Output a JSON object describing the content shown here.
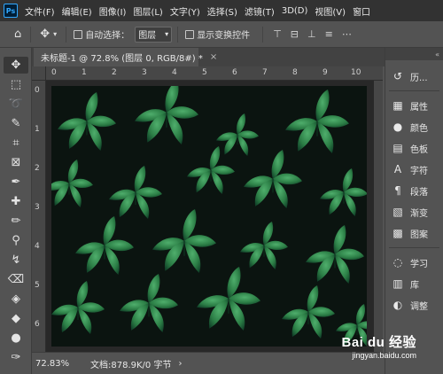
{
  "app": {
    "logo": "Ps"
  },
  "menu": [
    "文件(F)",
    "编辑(E)",
    "图像(I)",
    "图层(L)",
    "文字(Y)",
    "选择(S)",
    "滤镜(T)",
    "3D(D)",
    "视图(V)",
    "窗口"
  ],
  "options": {
    "auto_select_label": "自动选择：",
    "auto_select_value": "图层",
    "show_transform_label": "显示变换控件"
  },
  "document": {
    "tab_title": "未标题-1 @ 72.8% (图层 0, RGB/8#) *",
    "close_glyph": "×"
  },
  "rulers": {
    "horizontal": [
      "0",
      "1",
      "2",
      "3",
      "4",
      "5",
      "6",
      "7",
      "8",
      "9",
      "10"
    ],
    "vertical": [
      "0",
      "1",
      "2",
      "3",
      "4",
      "5",
      "6"
    ]
  },
  "status": {
    "zoom": "72.83%",
    "doc_info": "文档:878.9K/0 字节",
    "arrow": "›"
  },
  "panels": {
    "top_glyph": "«",
    "items": [
      {
        "icon": "history-icon",
        "glyph": "↺",
        "label": "历..."
      },
      {
        "icon": "properties-icon",
        "glyph": "▦",
        "label": "属性"
      },
      {
        "icon": "color-icon",
        "glyph": "●",
        "label": "颜色"
      },
      {
        "icon": "swatches-icon",
        "glyph": "▤",
        "label": "色板"
      },
      {
        "icon": "character-icon",
        "glyph": "A",
        "label": "字符"
      },
      {
        "icon": "paragraph-icon",
        "glyph": "¶",
        "label": "段落"
      },
      {
        "icon": "gradient-icon",
        "glyph": "▧",
        "label": "渐变"
      },
      {
        "icon": "patterns-icon",
        "glyph": "▩",
        "label": "图案"
      },
      {
        "icon": "learn-icon",
        "glyph": "◌",
        "label": "学习"
      },
      {
        "icon": "libraries-icon",
        "glyph": "▥",
        "label": "库"
      },
      {
        "icon": "adjustments-icon",
        "glyph": "◐",
        "label": "调整"
      }
    ]
  },
  "watermark": {
    "brand": "Bai du 经验",
    "url": "jingyan.baidu.com"
  },
  "colors": {
    "canvas": "#0c1511",
    "leaf": "#2f8a4e",
    "workspace": "#282828"
  }
}
